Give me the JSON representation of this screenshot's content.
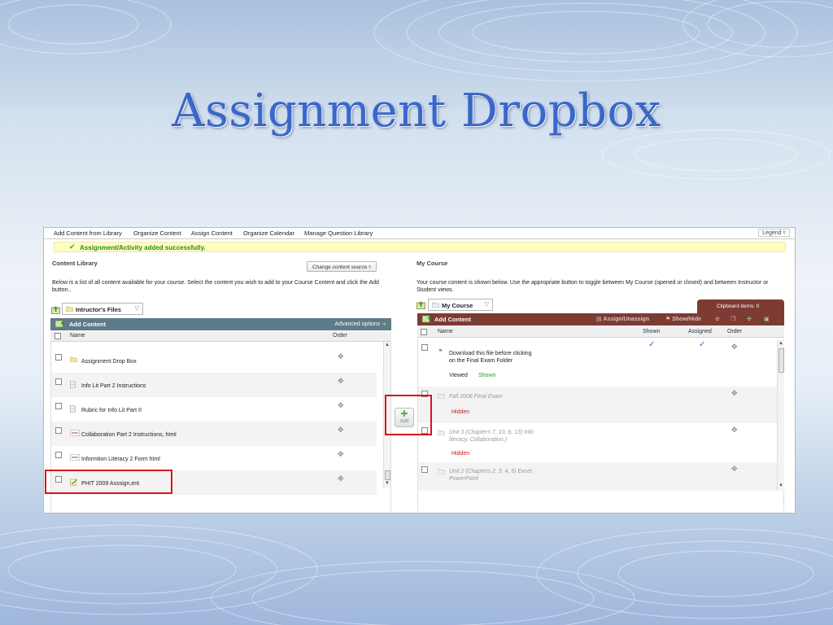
{
  "slide": {
    "title": "Assignment Dropbox"
  },
  "tabs": [
    "Add Content from Library",
    "Organize Content",
    "Assign Content",
    "Organize Calendar",
    "Manage Question Library"
  ],
  "legend_label": "Legend",
  "success_message": "Assignment/Activity added successfully.",
  "library": {
    "section_title": "Content Library",
    "change_source_label": "Change content source",
    "description": "Below is a list of all content available for your course. Select the content you wish to add to your Course Content and click the Add button..",
    "folder_name": "Intructor's Files",
    "header_title": "Add Content",
    "advanced_options": "Advanced options",
    "columns": {
      "name": "Name",
      "order": "Order"
    },
    "items": [
      {
        "name": "Assignment Drop Box",
        "icon": "folder-icon"
      },
      {
        "name": "Info Lit Part 2 Instructions",
        "icon": "document-icon"
      },
      {
        "name": "Rubric for Info Lit Part II",
        "icon": "document-icon"
      },
      {
        "name": "Collaboration Part 2 Instructions, html",
        "icon": "html-file-icon"
      },
      {
        "name": "Informtion Literacy 2 Form html",
        "icon": "html-file-icon"
      },
      {
        "name": "PHIT 2009 Asssign,ent",
        "icon": "assignment-icon"
      }
    ]
  },
  "add_button_label": "Add",
  "course": {
    "section_title": "My Course",
    "description": "Your course content is shown below. Use the appropriate button to toggle between My Course (opened or closed) and between Instructor or Student views.",
    "folder_name": "My Course",
    "header_title": "Add Content",
    "toolbar": {
      "assign": "Assign/Unassign",
      "show_hide": "Show/Hide"
    },
    "clipboard_label": "Clipboard items: 0",
    "columns": {
      "name": "Name",
      "shown": "Shown",
      "assigned": "Assigned",
      "order": "Order"
    },
    "items": [
      {
        "name_line1": "Download this file before clicking",
        "name_line2": "on the Final Exam Folder",
        "status1": "Viewed",
        "status2": "Shown",
        "shown": true,
        "assigned": true
      },
      {
        "name_line1": "Fall 2008 Final Exam",
        "name_line2": "",
        "status1": "Hidden",
        "shown": false,
        "assigned": false
      },
      {
        "name_line1": "Unit 3 (Chapters 7, 10, 8, 13) Info",
        "name_line2": "literacy, Collaboration.)",
        "status1": "Hidden",
        "shown": false,
        "assigned": false
      },
      {
        "name_line1": "Unit 2 (Chapters 2, 3, 4, 5) Excel,",
        "name_line2": "PowerPoint",
        "status1": "",
        "shown": false,
        "assigned": false
      }
    ]
  },
  "colors": {
    "title": "#3a67c9",
    "library_header": "#5d7b88",
    "course_header": "#7c3b33",
    "success_bg": "#fffcbf",
    "success_text": "#2b8a2b",
    "highlight": "#d6141c",
    "shown_text": "#2b9a2b",
    "hidden_text": "#d01a1a"
  }
}
